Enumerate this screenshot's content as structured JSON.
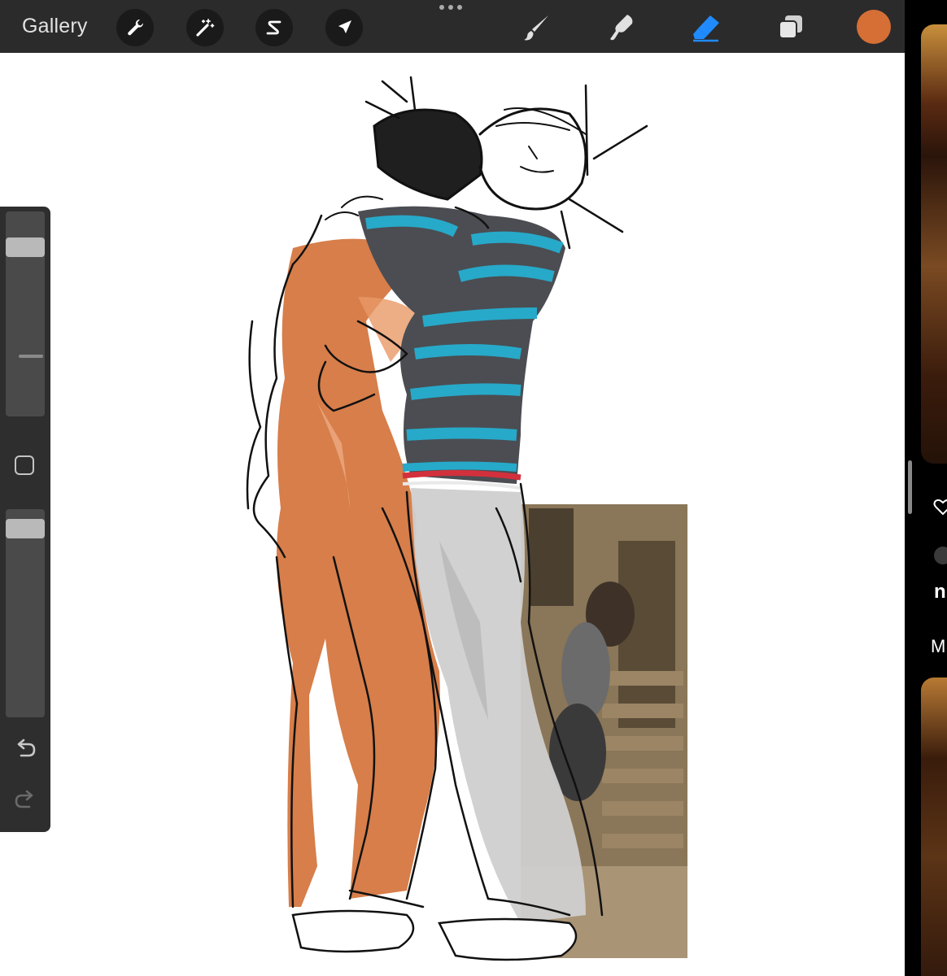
{
  "toolbar": {
    "gallery_label": "Gallery",
    "left_tools": [
      "wrench-icon",
      "magic-wand-icon",
      "selection-icon",
      "transform-arrow-icon"
    ],
    "right_tools": [
      "brush-icon",
      "smudge-icon",
      "eraser-icon",
      "layers-icon"
    ],
    "active_tool": "eraser-icon",
    "active_color": "#d56f35",
    "accent_color": "#1f8bff"
  },
  "sidebar": {
    "brush_size_level": 0.86,
    "opacity_level": 0.95,
    "icons": [
      "modify-square-icon",
      "undo-icon",
      "redo-icon"
    ]
  },
  "right_panel": {
    "text_1": "n",
    "text_2": "M"
  }
}
